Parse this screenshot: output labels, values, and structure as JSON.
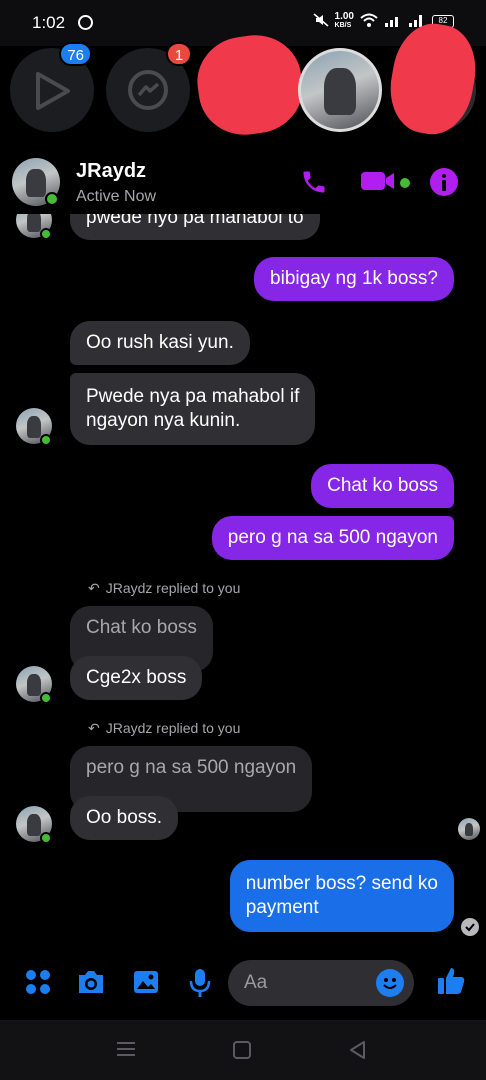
{
  "status_bar": {
    "time": "1:02",
    "net_speed": "1.00",
    "net_unit": "KB/S",
    "battery": "82"
  },
  "chat_heads": [
    {
      "name": "play-chat-head",
      "badge": "76"
    },
    {
      "name": "messenger-chat-head",
      "badge": "1"
    }
  ],
  "header": {
    "contact_name": "JRaydz",
    "active_status": "Active Now"
  },
  "messages": {
    "m0": "pwede nyo pa mahabol to",
    "m1": "bibigay ng 1k boss?",
    "m2": "Oo rush kasi yun.",
    "m3_line1": "Pwede nya pa mahabol if",
    "m3_line2": "ngayon nya kunin.",
    "m4": "Chat ko boss",
    "m5": "pero g na sa 500 ngayon",
    "reply1_note": "JRaydz replied to you",
    "reply1_quote": "Chat ko boss",
    "m6": "Cge2x boss",
    "reply2_note": "JRaydz replied to you",
    "reply2_quote": "pero g na sa 500 ngayon",
    "m7": "Oo boss.",
    "m8_line1": "number boss? send ko",
    "m8_line2": "payment"
  },
  "composer": {
    "placeholder": "Aa"
  },
  "colors": {
    "outgoing": "#8626e6",
    "incoming": "#303034",
    "accent": "#b01ff0",
    "blue": "#1a6fe8",
    "online": "#44bd32"
  }
}
